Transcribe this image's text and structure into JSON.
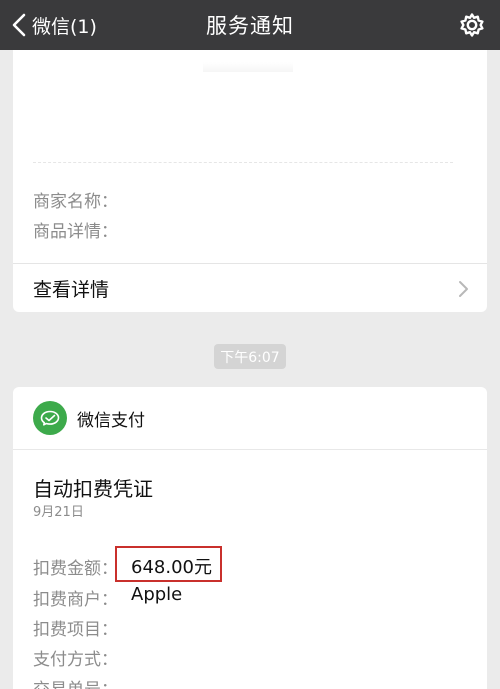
{
  "navbar": {
    "back_label": "微信(1)",
    "title": "服务通知",
    "back_icon": "chevron-left-icon",
    "settings_icon": "gear-icon"
  },
  "notice_card": {
    "fields": [
      {
        "label": "商家名称："
      },
      {
        "label": "商品详情："
      }
    ],
    "detail_label": "查看详情"
  },
  "timestamp": "下午6:07",
  "payment_card": {
    "source_name": "微信支付",
    "brand_color": "#3daa4b",
    "title": "自动扣费凭证",
    "date": "9月21日",
    "fields": [
      {
        "label": "扣费金额：",
        "value": "648.00元",
        "highlight_color": "#c9302c"
      },
      {
        "label": "扣费商户：",
        "value": "Apple"
      },
      {
        "label": "扣费项目：",
        "value": ""
      },
      {
        "label": "支付方式：",
        "value": ""
      },
      {
        "label": "交易单号：",
        "value": ""
      }
    ]
  }
}
